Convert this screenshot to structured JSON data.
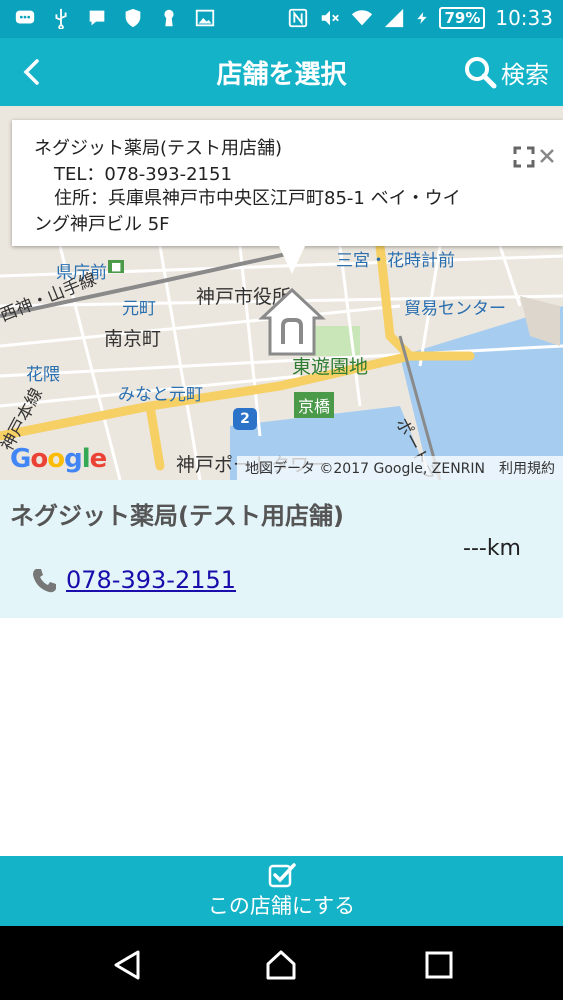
{
  "status_bar": {
    "battery": "79%",
    "time": "10:33"
  },
  "app_bar": {
    "title": "店舗を選択",
    "search_label": "検索"
  },
  "map": {
    "info_window": {
      "name": "ネグジット薬局(テスト用店舗)",
      "tel": "TEL：078-393-2151",
      "address_line1": "住所：兵庫県神戸市中央区江戸町85-1 ベイ・ウイ",
      "address_line2": "ング神戸ビル 5F"
    },
    "labels": {
      "kenchomae": "県庁前",
      "sannomiya": "三宮・花時計前",
      "kobe_city_hall": "神戸市役所",
      "motomachi": "元町",
      "boeki_center": "貿易センター",
      "nankinmachi": "南京町",
      "higashi_yuenchi": "東遊園地",
      "hanakuma": "花隈",
      "minato_motomachi": "みなと元町",
      "kyobashi": "京橋",
      "kobe_port_tower": "神戸ポートタワー",
      "port_liner": "ポートライナー",
      "sanyo_line": "西神・山手線",
      "main_line": "神戸本線",
      "route_number": "2"
    },
    "google_logo": "Google",
    "attribution": "地図データ ©2017 Google, ZENRIN",
    "terms": "利用規約"
  },
  "store": {
    "name": "ネグジット薬局(テスト用店舗)",
    "distance": "---km",
    "phone": "078-393-2151"
  },
  "select_button": {
    "label": "この店舗にする"
  },
  "colors": {
    "primary": "#14b3c8",
    "status_bar": "#0aa2bd",
    "card_bg": "#e4f5fa",
    "link": "#1a0dab"
  }
}
